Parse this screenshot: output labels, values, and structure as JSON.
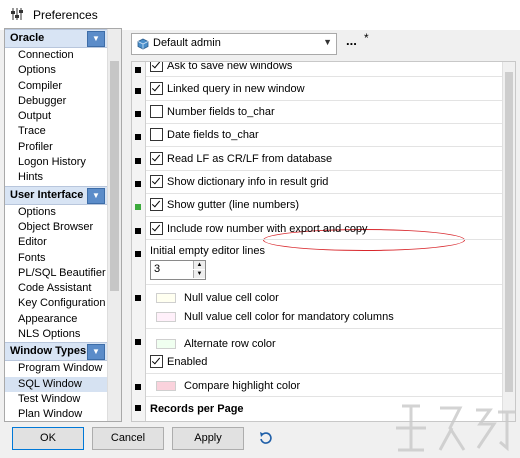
{
  "window": {
    "title": "Preferences"
  },
  "sidebar": {
    "groups": [
      {
        "label": "Oracle",
        "items": [
          "Connection",
          "Options",
          "Compiler",
          "Debugger",
          "Output",
          "Trace",
          "Profiler",
          "Logon History",
          "Hints"
        ]
      },
      {
        "label": "User Interface",
        "items": [
          "Options",
          "Object Browser",
          "Editor",
          "Fonts",
          "PL/SQL Beautifier",
          "Code Assistant",
          "Key Configuration",
          "Appearance",
          "NLS Options"
        ]
      },
      {
        "label": "Window Types",
        "items": [
          "Program Window",
          "SQL Window",
          "Test Window",
          "Plan Window"
        ]
      }
    ],
    "selected": "SQL Window"
  },
  "profile": {
    "selected": "Default admin",
    "ellipsis": "...",
    "modified": "*"
  },
  "settings": {
    "ask_save": {
      "label": "Ask to save new windows",
      "checked": true
    },
    "linked_query": {
      "label": "Linked query in new window",
      "checked": true
    },
    "number_fields": {
      "label": "Number fields to_char",
      "checked": false
    },
    "date_fields": {
      "label": "Date fields to_char",
      "checked": false
    },
    "read_lf": {
      "label": "Read LF as CR/LF from database",
      "checked": true
    },
    "dict_info": {
      "label": "Show dictionary info in result grid",
      "checked": true
    },
    "show_gutter": {
      "label": "Show gutter (line numbers)",
      "checked": true
    },
    "row_number": {
      "label": "Include row number with export and copy",
      "checked": true
    },
    "empty_lines": {
      "label": "Initial empty editor lines",
      "value": "3"
    },
    "null_color": {
      "label": "Null value cell color",
      "color": "#fffff0"
    },
    "null_mandatory_color": {
      "label": "Null value cell color for mandatory columns",
      "color": "#fff0fa"
    },
    "alt_row": {
      "label": "Alternate row color",
      "color": "#f0fff0"
    },
    "alt_enabled": {
      "label": "Enabled",
      "checked": true
    },
    "compare_color": {
      "label": "Compare highlight color",
      "color": "#fad2dc"
    },
    "records_heading": "Records per Page"
  },
  "buttons": {
    "ok": "OK",
    "cancel": "Cancel",
    "apply": "Apply"
  },
  "colors": {
    "accent": "#0078d7",
    "annotation": "#d8262b",
    "group_header": "#d8e4f4"
  }
}
